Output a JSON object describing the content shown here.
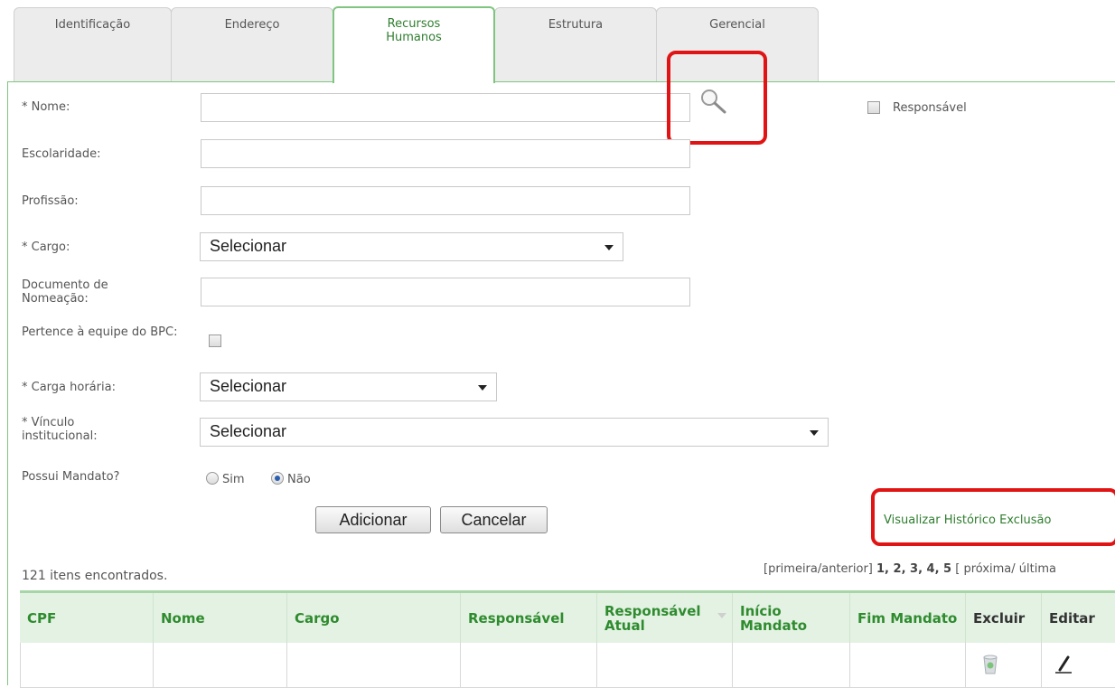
{
  "tabs": [
    {
      "label": "Identificação"
    },
    {
      "label": "Endereço"
    },
    {
      "label": "Recursos Humanos",
      "active": true
    },
    {
      "label": "Estrutura"
    },
    {
      "label": "Gerencial"
    }
  ],
  "form": {
    "nome_label": "* Nome:",
    "responsavel_label": "Responsável",
    "escolaridade_label": "Escolaridade:",
    "profissao_label": "Profissão:",
    "cargo_label": "* Cargo:",
    "cargo_value": "Selecionar",
    "documento_label": "Documento de Nomeação:",
    "pertence_label": "Pertence à equipe do BPC:",
    "carga_label": "* Carga horária:",
    "carga_value": "Selecionar",
    "vinculo_label": "* Vínculo institucional:",
    "vinculo_value": "Selecionar",
    "mandato_label": "Possui Mandato?",
    "mandato_sim": "Sim",
    "mandato_nao": "Não",
    "mandato_selected": "Não"
  },
  "buttons": {
    "adicionar": "Adicionar",
    "cancelar": "Cancelar"
  },
  "historico_link": "Visualizar Histórico Exclusão",
  "results": {
    "count_text": "121 itens encontrados.",
    "pager_prefix": "[primeira/anterior]",
    "pages": "1, 2, 3, 4, 5",
    "pager_suffix": "[ próxima/ última"
  },
  "table": {
    "headers": [
      "CPF",
      "Nome",
      "Cargo",
      "Responsável",
      "Responsável Atual",
      "Início Mandato",
      "Fim Mandato",
      "Excluir",
      "Editar"
    ]
  },
  "icons": {
    "search": "magnifier-icon",
    "delete": "trash-icon",
    "edit": "pencil-icon"
  },
  "colors": {
    "accent_green": "#2e8b2e",
    "header_bg": "#e4f2e4",
    "highlight_red": "#e01414"
  }
}
